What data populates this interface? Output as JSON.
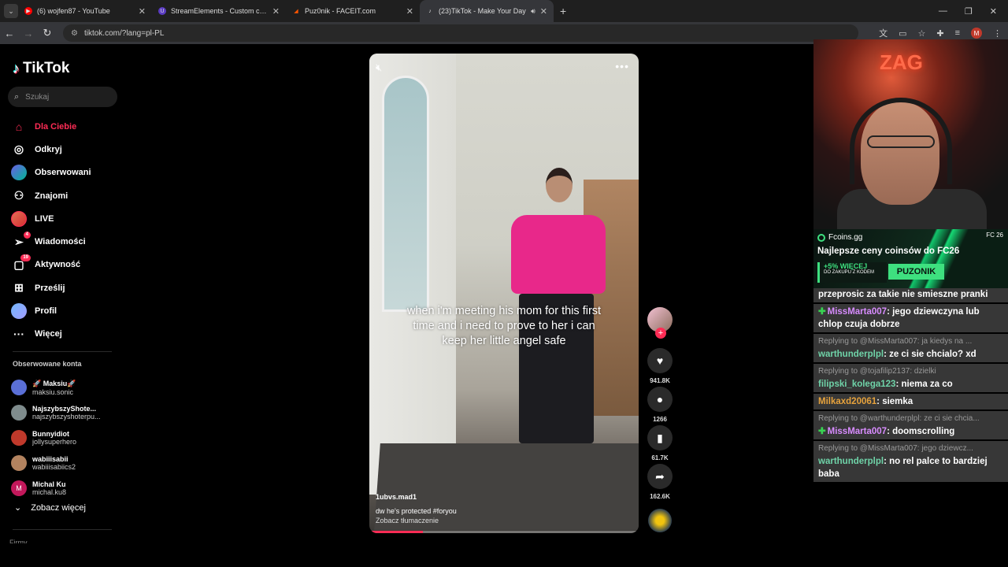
{
  "browser": {
    "tabs": [
      {
        "title": "(6) wojfen87 - YouTube",
        "favicon_color": "#ff0000"
      },
      {
        "title": "StreamElements - Custom comma",
        "favicon_color": "#5b3cc4"
      },
      {
        "title": "Puz0nik - FACEIT.com",
        "favicon_color": "#ff5500"
      },
      {
        "title": "(23)TikTok - Make Your Day",
        "favicon_color": "#000000"
      }
    ],
    "url": "tiktok.com/?lang=pl-PL",
    "profile_initial": "M"
  },
  "tiktok": {
    "logo": "TikTok",
    "search_placeholder": "Szukaj",
    "nav": [
      {
        "label": "Dla Ciebie",
        "icon": "home-icon",
        "active": true
      },
      {
        "label": "Odkryj",
        "icon": "compass-icon"
      },
      {
        "label": "Obserwowani",
        "icon": "avatar-icon"
      },
      {
        "label": "Znajomi",
        "icon": "friends-icon"
      },
      {
        "label": "LIVE",
        "icon": "live-icon"
      },
      {
        "label": "Wiadomości",
        "icon": "send-icon",
        "badge": "4"
      },
      {
        "label": "Aktywność",
        "icon": "bell-icon",
        "badge": "19"
      },
      {
        "label": "Prześlij",
        "icon": "upload-icon"
      },
      {
        "label": "Profil",
        "icon": "profile-icon"
      },
      {
        "label": "Więcej",
        "icon": "more-icon"
      }
    ],
    "following_title": "Obserwowane konta",
    "following": [
      {
        "name": "🚀 Maksiu🚀",
        "handle": "maksiu.sonic",
        "color": "#5a6fd6"
      },
      {
        "name": "NajszybszyShote...",
        "handle": "najszybszyshoterpu...",
        "color": "#7f8c8d"
      },
      {
        "name": "Bunnyidiot",
        "handle": "jollysuperhero",
        "color": "#c0392b"
      },
      {
        "name": "wabiiisabii",
        "handle": "wabiiisabiics2",
        "color": "#b3835f"
      },
      {
        "name": "Michal Ku",
        "handle": "michal.ku8",
        "color": "#c2185b",
        "initial": "M"
      }
    ],
    "see_more": "Zobacz więcej",
    "cut_label": "Firmy"
  },
  "video": {
    "caption": "when i'm meeting his mom for this first time and i need to prove to her i can keep her little angel safe",
    "author": "1ubvs.mad1",
    "description": "dw he's protected #foryou",
    "translate": "Zobacz tłumaczenie",
    "progress": 0.2,
    "likes": "941.8K",
    "comments": "1266",
    "saves": "61.7K",
    "shares": "162.6K"
  },
  "overlay": {
    "webcam_sign": "ZAG",
    "sponsor": {
      "brand": "Fcoins.gg",
      "platforms": "FC 26",
      "headline": "Najlepsze ceny coinsów do FC26",
      "bonus": "+5% WIĘCEJ",
      "bonus_sub": "DO ZAKUPU Z KODEM",
      "code": "PUZONIK"
    },
    "chat": [
      {
        "user": "",
        "text": "przeprosic za takie nie smieszne pranki",
        "user_color": "",
        "partial": true
      },
      {
        "user": "MissMarta007",
        "text": ": jego dziewczyna lub chlop czuja dobrze",
        "user_color": "pink",
        "sub": true
      },
      {
        "reply": "Replying to @MissMarta007: ja kiedys na ...",
        "user": "warthunderplpl",
        "text": ": ze ci sie chcialo? xd",
        "user_color": "green"
      },
      {
        "reply": "Replying to @tojafilip2137: dzielki",
        "user": "filipski_kolega123",
        "text": ": niema za co",
        "user_color": "green"
      },
      {
        "user": "Milkaxd20061",
        "text": ": siemka",
        "user_color": "orange"
      },
      {
        "reply": "Replying to @warthunderplpl: ze ci sie chcia...",
        "user": "MissMarta007",
        "text": ": doomscrolling",
        "user_color": "pink",
        "sub": true
      },
      {
        "reply": "Replying to @MissMarta007: jego dziewcz...",
        "user": "warthunderplpl",
        "text": ": no rel palce to bardziej baba",
        "user_color": "green"
      }
    ]
  }
}
